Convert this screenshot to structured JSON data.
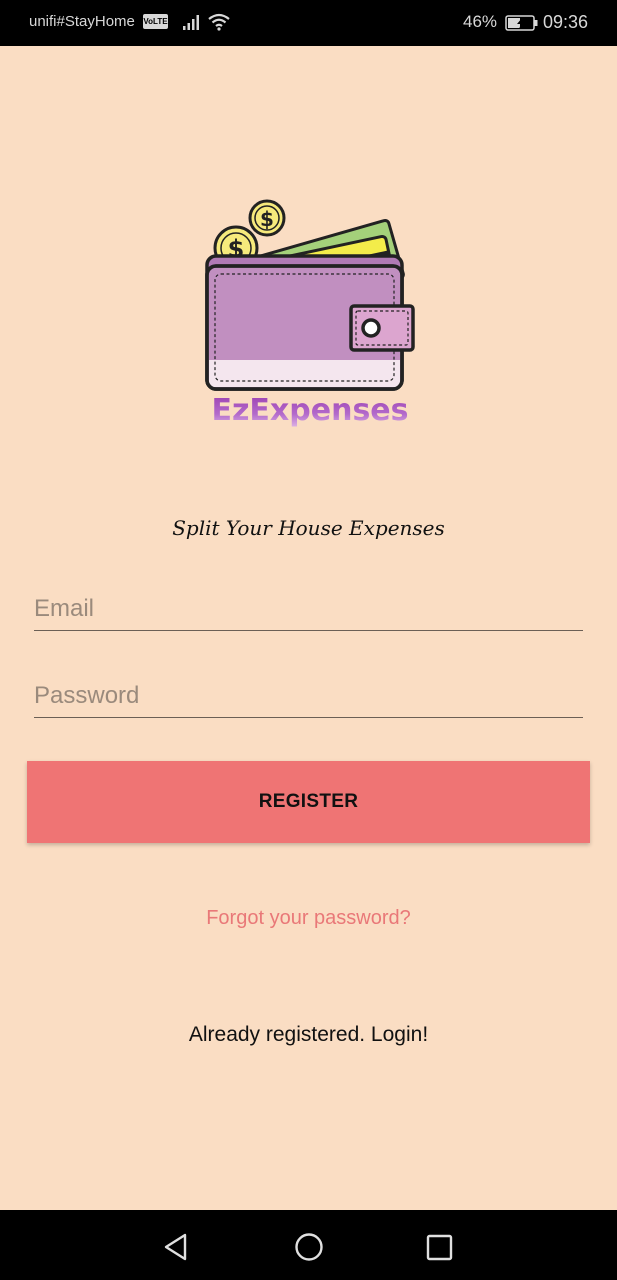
{
  "status_bar": {
    "carrier": "unifi#StayHome",
    "volte_badge": "VoLTE",
    "battery_percent": "46%",
    "time": "09:36"
  },
  "logo": {
    "app_name": "EzExpenses",
    "name_color": "#9B3FB0"
  },
  "tagline": "Split Your House Expenses",
  "form": {
    "email_placeholder": "Email",
    "password_placeholder": "Password",
    "register_label": "REGISTER"
  },
  "links": {
    "forgot_password": "Forgot your password?",
    "login": "Already registered. Login!"
  },
  "nav_bar": {
    "back_icon": "triangle-back-icon",
    "home_icon": "circle-home-icon",
    "recents_icon": "square-recents-icon"
  },
  "colors": {
    "background": "#FADDC3",
    "button": "#EF7474",
    "link": "#E97878"
  }
}
